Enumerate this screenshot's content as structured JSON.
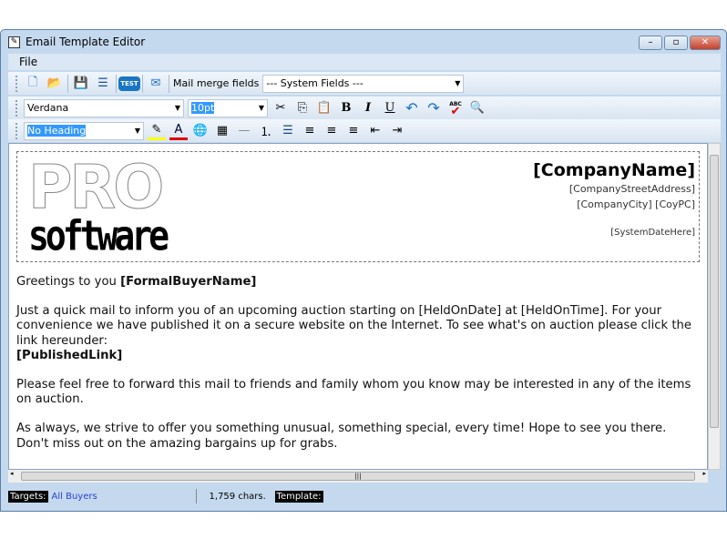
{
  "window": {
    "title": "Email Template Editor"
  },
  "menu": {
    "file": "File"
  },
  "toolbar1": {
    "mail_merge_label": "Mail merge fields",
    "mail_merge_value": "--- System Fields ---",
    "test_label": "TEST"
  },
  "toolbar2": {
    "font": "Verdana",
    "size": "10pt",
    "bold": "B",
    "italic": "I",
    "underline": "U",
    "spell": "ABC"
  },
  "toolbar3": {
    "heading": "No Heading"
  },
  "header": {
    "logo_top": "PRO",
    "logo_bottom": "software",
    "company": "[CompanyName]",
    "street": "[CompanyStreetAddress]",
    "city": "[CompanyCity] [CoyPC]",
    "date": "[SystemDateHere]"
  },
  "body": {
    "greeting": "Greetings to you ",
    "buyer": "[FormalBuyerName]",
    "p1": "Just a quick mail to inform you of an upcoming auction starting on [HeldOnDate] at [HeldOnTime]. For your convenience we have published it on a secure website on the Internet. To see what's on auction please click the link hereunder:",
    "link": "[PublishedLink]",
    "p2": "Please feel free to forward this mail to friends and family whom you know may be interested in any of the items on auction.",
    "p3": "As always, we strive to offer you something unusual, something special, every time! Hope to see you there. Don't miss out on the amazing bargains up for grabs."
  },
  "status": {
    "targets_label": "Targets:",
    "targets_value": "All Buyers",
    "chars": "1,759 chars.",
    "template_label": "Template:"
  }
}
